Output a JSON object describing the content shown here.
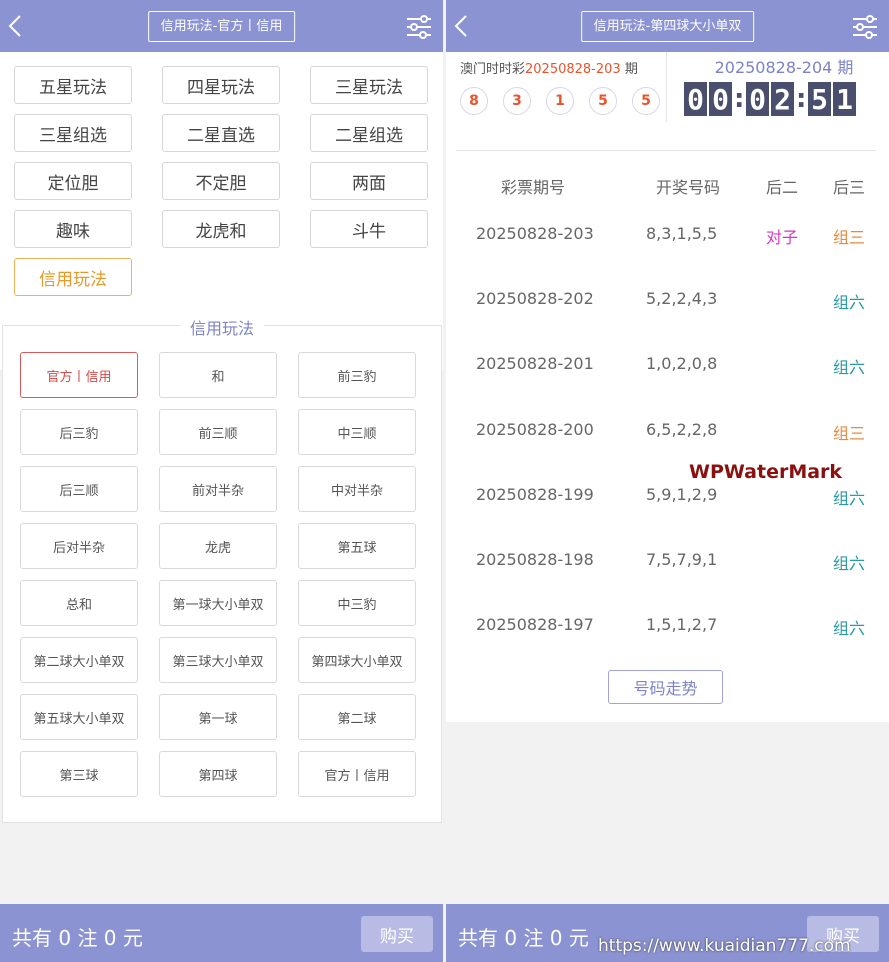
{
  "left": {
    "header_title": "信用玩法-官方丨信用",
    "play_types": [
      "五星玩法",
      "四星玩法",
      "三星玩法",
      "三星组选",
      "二星直选",
      "二星组选",
      "定位胆",
      "不定胆",
      "两面",
      "趣味",
      "龙虎和",
      "斗牛",
      "信用玩法"
    ],
    "active_play_type": "信用玩法",
    "sub_title": "信用玩法",
    "sub_options": [
      "官方丨信用",
      "和",
      "前三豹",
      "后三豹",
      "前三顺",
      "中三顺",
      "后三顺",
      "前对半杂",
      "中对半杂",
      "后对半杂",
      "龙虎",
      "第五球",
      "总和",
      "第一球大小单双",
      "中三豹",
      "第二球大小单双",
      "第三球大小单双",
      "第四球大小单双",
      "第五球大小单双",
      "第一球",
      "第二球",
      "第三球",
      "第四球",
      "官方丨信用"
    ],
    "active_sub_option": "官方丨信用",
    "footer_summary": "共有 0 注 0 元",
    "buy_label": "购买"
  },
  "right": {
    "header_title": "信用玩法-第四球大小单双",
    "lottery_name": "澳门时时彩",
    "last_period": "20250828-203",
    "period_suffix": "期",
    "last_balls": [
      "8",
      "3",
      "1",
      "5",
      "5"
    ],
    "next_period": "20250828-204 期",
    "countdown": [
      "0",
      "0",
      ":",
      "0",
      "2",
      ":",
      "5",
      "1"
    ],
    "table_headers": [
      "彩票期号",
      "开奖号码",
      "后二",
      "后三"
    ],
    "history": [
      {
        "period": "20250828-203",
        "numbers": "8,3,1,5,5",
        "hou2": "对子",
        "hou3": "组三"
      },
      {
        "period": "20250828-202",
        "numbers": "5,2,2,4,3",
        "hou2": "",
        "hou3": "组六"
      },
      {
        "period": "20250828-201",
        "numbers": "1,0,2,0,8",
        "hou2": "",
        "hou3": "组六"
      },
      {
        "period": "20250828-200",
        "numbers": "6,5,2,2,8",
        "hou2": "",
        "hou3": "组三"
      },
      {
        "period": "20250828-199",
        "numbers": "5,9,1,2,9",
        "hou2": "",
        "hou3": "组六"
      },
      {
        "period": "20250828-198",
        "numbers": "7,5,7,9,1",
        "hou2": "",
        "hou3": "组六"
      },
      {
        "period": "20250828-197",
        "numbers": "1,5,1,2,7",
        "hou2": "",
        "hou3": "组六"
      }
    ],
    "trend_label": "号码走势",
    "watermark": "WPWaterMark",
    "footer_summary": "共有 0 注 0 元",
    "buy_label": "购买",
    "site_url": "https://www.kuaidian777.com"
  },
  "colors": {
    "header": "#8c93d2",
    "accent_red": "#e8542e",
    "pair": "#d436c7",
    "group3": "#e88a3e",
    "group6": "#2a9aa3"
  }
}
